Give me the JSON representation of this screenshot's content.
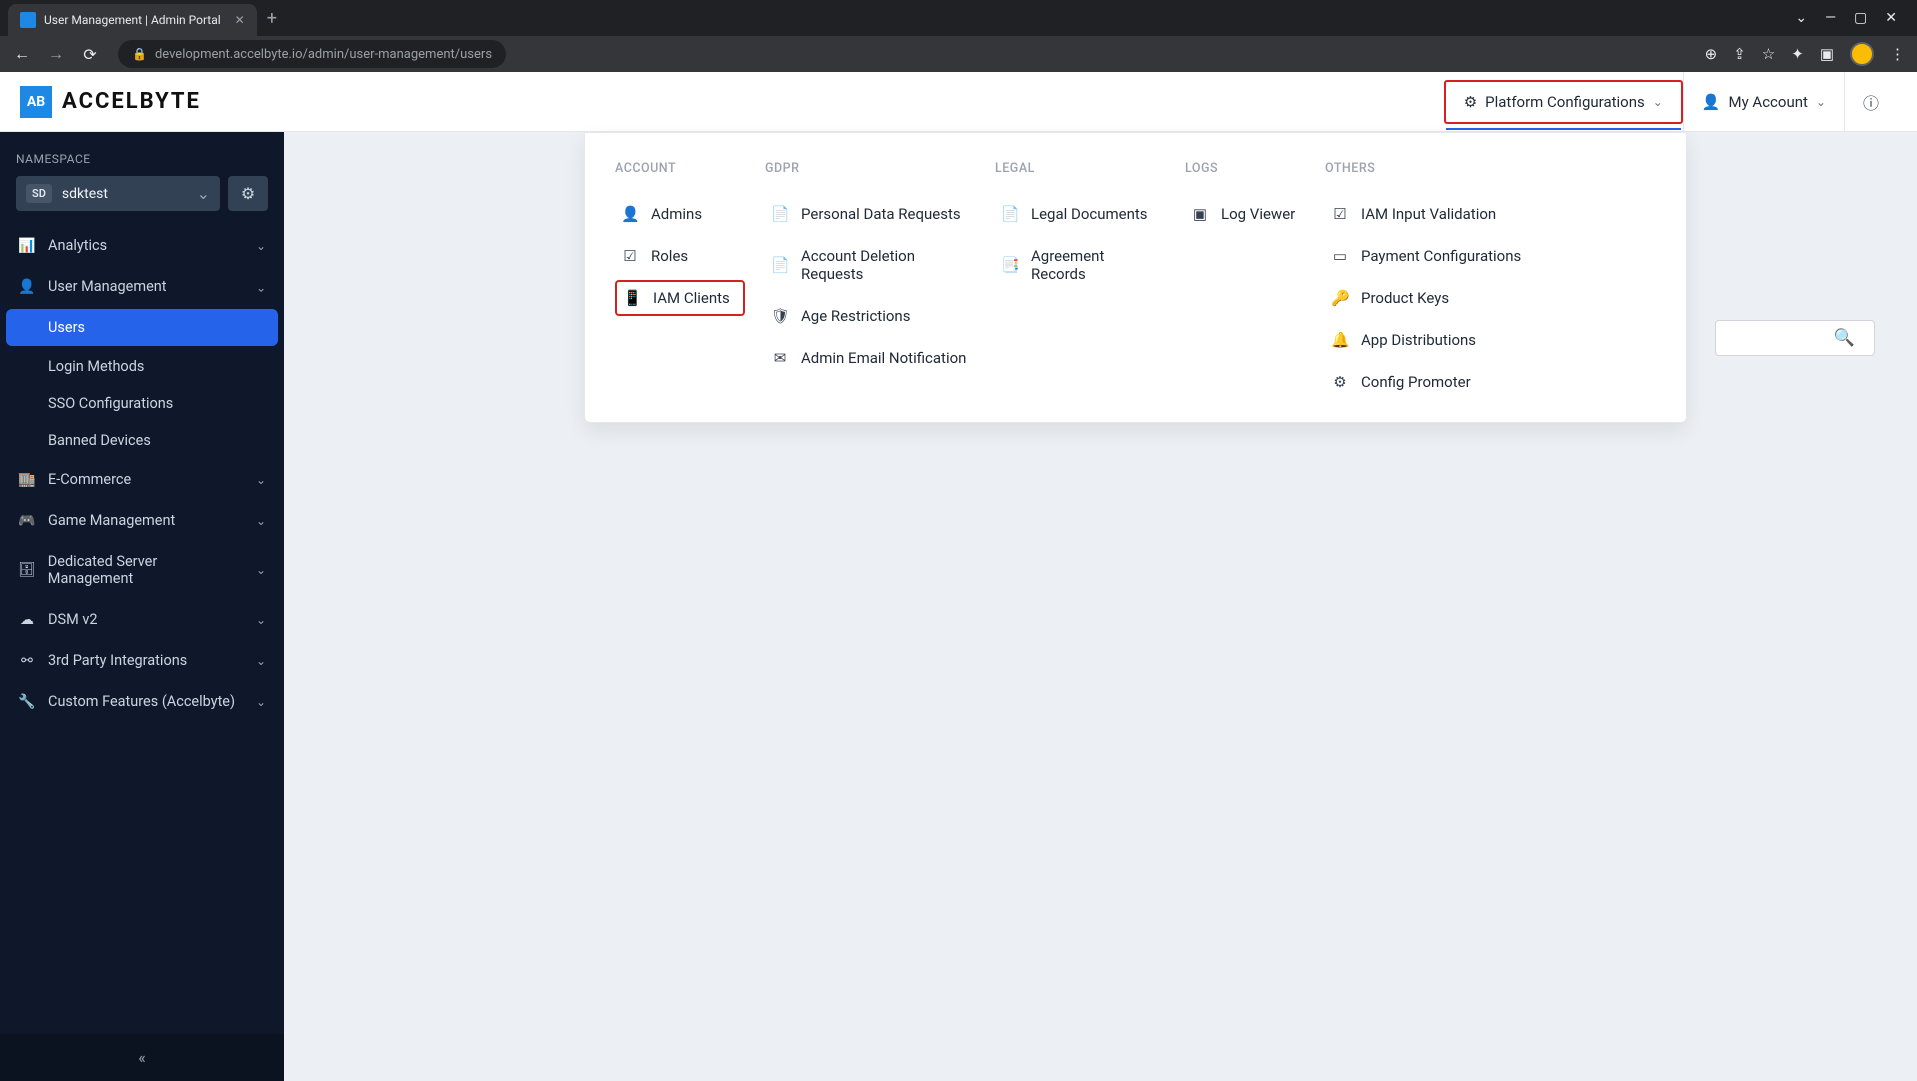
{
  "browser": {
    "tab_title": "User Management | Admin Portal",
    "url": "development.accelbyte.io/admin/user-management/users"
  },
  "logo_text": "ACCELBYTE",
  "header": {
    "platform_config": "Platform Configurations",
    "my_account": "My Account"
  },
  "sidebar": {
    "namespace_label": "NAMESPACE",
    "namespace_badge": "SD",
    "namespace_name": "sdktest",
    "items": [
      {
        "label": "Analytics"
      },
      {
        "label": "User Management"
      },
      {
        "label": "E-Commerce"
      },
      {
        "label": "Game Management"
      },
      {
        "label": "Dedicated Server Management"
      },
      {
        "label": "DSM v2"
      },
      {
        "label": "3rd Party Integrations"
      },
      {
        "label": "Custom Features (Accelbyte)"
      }
    ],
    "user_mgmt_sub": [
      {
        "label": "Users"
      },
      {
        "label": "Login Methods"
      },
      {
        "label": "SSO Configurations"
      },
      {
        "label": "Banned Devices"
      }
    ]
  },
  "dropdown": {
    "columns": {
      "account": {
        "header": "ACCOUNT",
        "items": [
          "Admins",
          "Roles",
          "IAM Clients"
        ]
      },
      "gdpr": {
        "header": "GDPR",
        "items": [
          "Personal Data Requests",
          "Account Deletion Requests",
          "Age Restrictions",
          "Admin Email Notification"
        ]
      },
      "legal": {
        "header": "LEGAL",
        "items": [
          "Legal Documents",
          "Agreement Records"
        ]
      },
      "logs": {
        "header": "LOGS",
        "items": [
          "Log Viewer"
        ]
      },
      "others": {
        "header": "OTHERS",
        "items": [
          "IAM Input Validation",
          "Payment Configurations",
          "Product Keys",
          "App Distributions",
          "Config Promoter"
        ]
      }
    }
  }
}
